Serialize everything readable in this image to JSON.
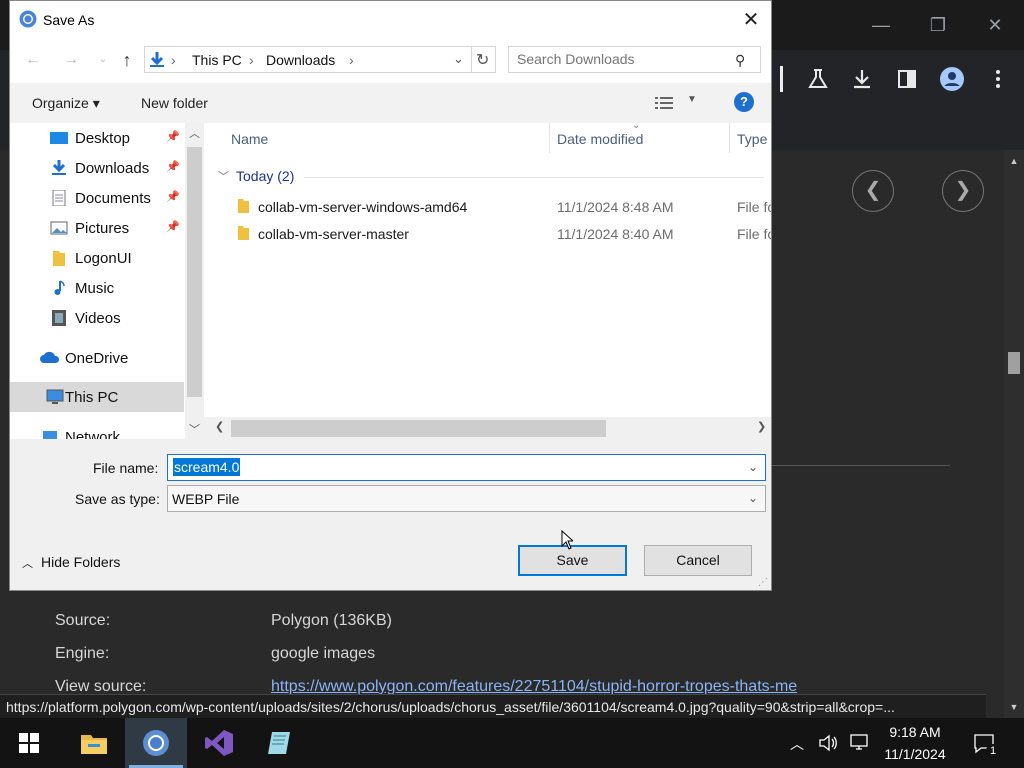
{
  "browser": {
    "source_label": "Source:",
    "source_value": "Polygon (136KB)",
    "engine_label": "Engine:",
    "engine_value": "google images",
    "view_source_label": "View source:",
    "view_source_link": "https://www.polygon.com/features/22751104/stupid-horror-tropes-thats-me",
    "status_url": "https://platform.polygon.com/wp-content/uploads/sites/2/chorus/uploads/chorus_asset/file/3601104/scream4.0.jpg?quality=90&strip=all&crop=..."
  },
  "dialog": {
    "title": "Save As",
    "address": {
      "crumb_1": "This PC",
      "crumb_2": "Downloads"
    },
    "search_placeholder": "Search Downloads",
    "commands": {
      "organize": "Organize ▾",
      "new_folder": "New folder"
    },
    "nav_items": [
      {
        "label": "Desktop",
        "icon": "desktop-icon"
      },
      {
        "label": "Downloads",
        "icon": "downloads-icon"
      },
      {
        "label": "Documents",
        "icon": "documents-icon"
      },
      {
        "label": "Pictures",
        "icon": "pictures-icon"
      },
      {
        "label": "LogonUI",
        "icon": "folder-icon"
      },
      {
        "label": "Music",
        "icon": "music-icon"
      },
      {
        "label": "Videos",
        "icon": "videos-icon"
      },
      {
        "label": "OneDrive",
        "icon": "onedrive-icon"
      },
      {
        "label": "This PC",
        "icon": "this-pc-icon"
      },
      {
        "label": "Network",
        "icon": "network-icon"
      }
    ],
    "columns": {
      "name": "Name",
      "date_modified": "Date modified",
      "type": "Type"
    },
    "group_label": "Today (2)",
    "files": [
      {
        "name": "collab-vm-server-windows-amd64",
        "date": "11/1/2024 8:48 AM",
        "type": "File fo"
      },
      {
        "name": "collab-vm-server-master",
        "date": "11/1/2024 8:40 AM",
        "type": "File fo"
      }
    ],
    "file_name_label": "File name:",
    "file_name_value": "scream4.0",
    "save_type_label": "Save as type:",
    "save_type_value": "WEBP File",
    "hide_folders": "Hide Folders",
    "save_button": "Save",
    "cancel_button": "Cancel"
  },
  "taskbar": {
    "time": "9:18 AM",
    "date": "11/1/2024",
    "notification_count": "1"
  },
  "colors": {
    "accent": "#0078d7",
    "link": "#8ab4f8"
  }
}
